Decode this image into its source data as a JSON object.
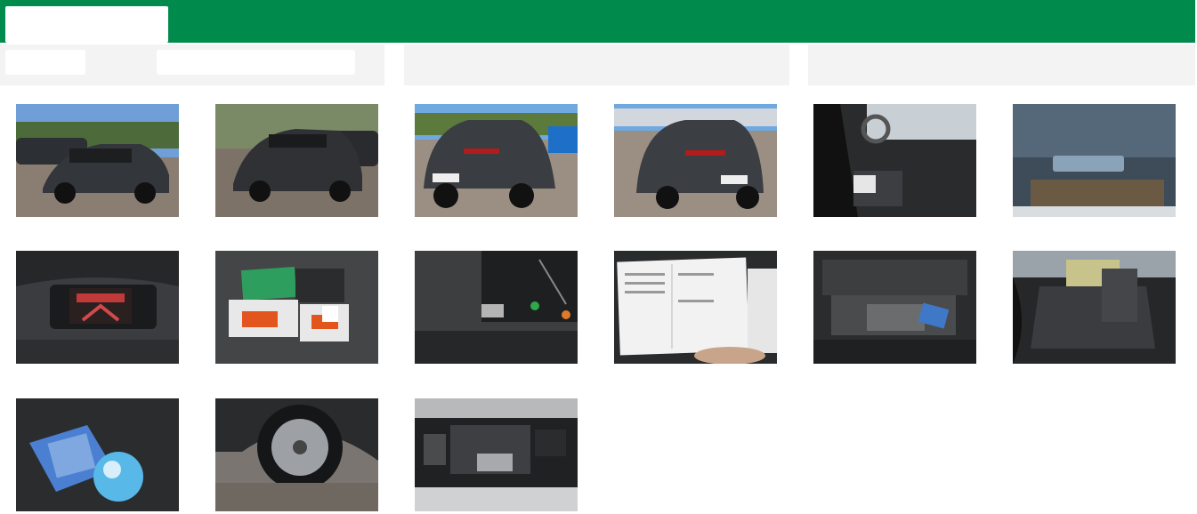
{
  "header": {
    "brand_color": "#008a4b"
  },
  "gallery": {
    "photos": [
      {
        "subject": "car-front-left-exterior"
      },
      {
        "subject": "car-front-right-exterior"
      },
      {
        "subject": "car-rear-left-exterior"
      },
      {
        "subject": "car-rear-right-exterior"
      },
      {
        "subject": "driver-interior"
      },
      {
        "subject": "windshield-vin-plate"
      },
      {
        "subject": "instrument-cluster"
      },
      {
        "subject": "manuals-and-keys"
      },
      {
        "subject": "infotainment-display"
      },
      {
        "subject": "service-booklet"
      },
      {
        "subject": "trunk"
      },
      {
        "subject": "rear-seats"
      },
      {
        "subject": "repair-kit"
      },
      {
        "subject": "wheel-tire"
      },
      {
        "subject": "engine-bay"
      }
    ]
  }
}
